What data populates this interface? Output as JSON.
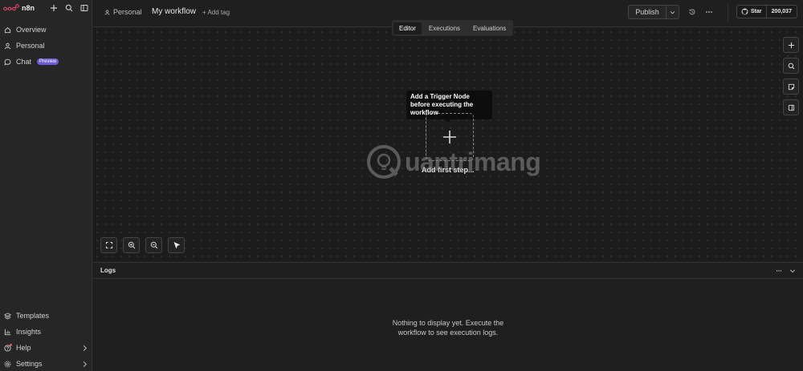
{
  "app": {
    "name": "n8n"
  },
  "sidebar": {
    "top_items": [
      {
        "label": "Overview",
        "icon": "home-icon"
      },
      {
        "label": "Personal",
        "icon": "user-icon"
      },
      {
        "label": "Chat",
        "icon": "chat-icon",
        "badge": "Preview"
      }
    ],
    "bottom_items": [
      {
        "label": "Templates",
        "icon": "templates-icon"
      },
      {
        "label": "Insights",
        "icon": "insights-icon"
      },
      {
        "label": "Help",
        "icon": "help-icon"
      },
      {
        "label": "Settings",
        "icon": "settings-icon"
      }
    ]
  },
  "header": {
    "breadcrumb_project": "Personal",
    "workflow_name": "My workflow",
    "add_tag": "+ Add tag",
    "publish_label": "Publish",
    "github_star_label": "Star",
    "github_star_count": "200,037"
  },
  "tabs": [
    {
      "label": "Editor",
      "active": true
    },
    {
      "label": "Executions",
      "active": false
    },
    {
      "label": "Evaluations",
      "active": false
    }
  ],
  "canvas": {
    "tooltip": "Add a Trigger Node before executing the workflow",
    "add_first_step": "Add first step..."
  },
  "logs": {
    "title": "Logs",
    "empty_line1": "Nothing to display yet. Execute the",
    "empty_line2": "workflow to see execution logs."
  },
  "watermark": {
    "text": "uantrimang"
  },
  "colors": {
    "background": "#1f1f1f",
    "sidebar": "#262626",
    "accent_badge": "#6b5bd6",
    "logo": "#ea4b71"
  }
}
